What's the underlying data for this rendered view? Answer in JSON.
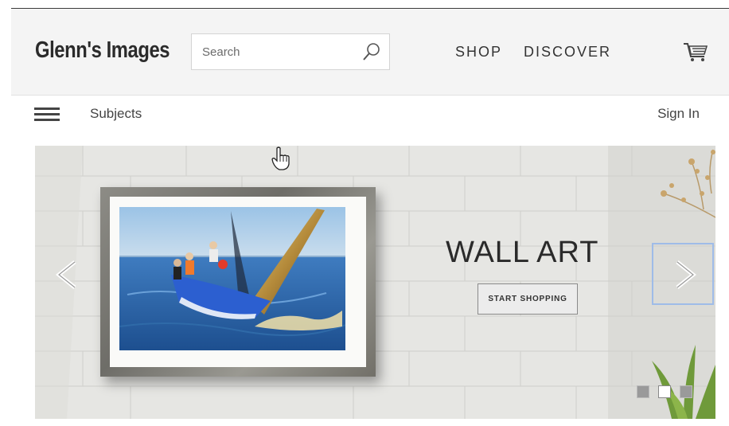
{
  "header": {
    "logo": "Glenn's Images",
    "search": {
      "placeholder": "Search",
      "value": ""
    },
    "nav": [
      {
        "label": "SHOP"
      },
      {
        "label": "DISCOVER"
      }
    ],
    "cart_icon": "shopping-cart-icon"
  },
  "subnav": {
    "menu_icon": "hamburger-menu-icon",
    "subjects_label": "Subjects",
    "signin_label": "Sign In"
  },
  "hero": {
    "title": "WALL ART",
    "cta_label": "START SHOPPING",
    "prev_icon": "chevron-left-icon",
    "next_icon": "chevron-right-icon",
    "slides_total": 3,
    "active_slide": 2
  },
  "colors": {
    "header_bg": "#f4f4f4",
    "text": "#333333",
    "focus_outline": "#9fbce8"
  }
}
